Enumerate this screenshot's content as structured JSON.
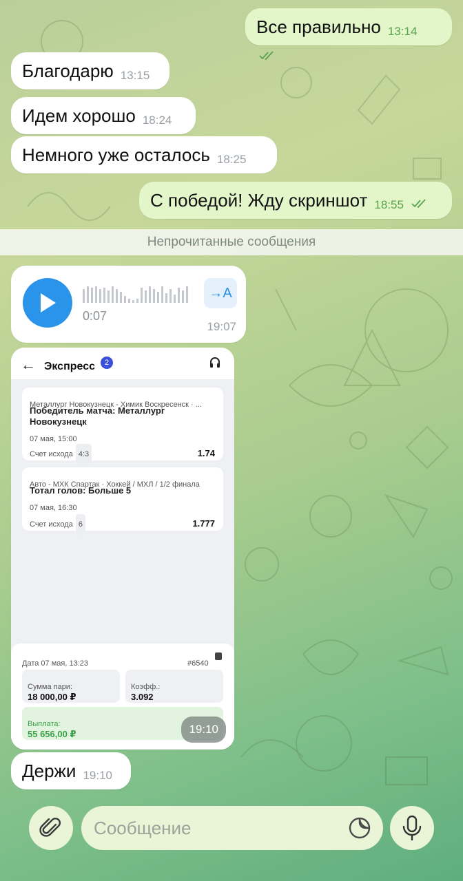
{
  "messages": [
    {
      "text": "Все правильно",
      "time": "13:14",
      "dir": "out"
    },
    {
      "text": "Благодарю",
      "time": "13:15",
      "dir": "in"
    },
    {
      "text": "Идем хорошо",
      "time": "18:24",
      "dir": "in"
    },
    {
      "text": "Немного уже осталось",
      "time": "18:25",
      "dir": "in"
    },
    {
      "text": "С победой! Жду скриншот",
      "time": "18:55",
      "dir": "out"
    }
  ],
  "unread_divider": "Непрочитанные сообщения",
  "voice": {
    "duration": "0:07",
    "time": "19:07",
    "transcribe_label": "→A",
    "icon": "play-icon"
  },
  "screenshot": {
    "time": "19:10",
    "header": {
      "title": "Экспресс",
      "badge": "2",
      "back_icon": "arrow-left-icon",
      "support_icon": "headset-icon"
    },
    "cards": [
      {
        "league": "Металлург Новокузнецк - Химик Воскресенск · ...",
        "pick": "Победитель матча: Металлург Новокузнецк",
        "date": "07 мая, 15:00",
        "result_label": "Счет исхода",
        "result": "4:3",
        "odds": "1.74"
      },
      {
        "league": "Авто - МХК Спартак · Хоккей / МХЛ / 1/2 финала",
        "pick": "Тотал голов: Больше 5",
        "date": "07 мая, 16:30",
        "result_label": "Счет исхода",
        "result": "6",
        "odds": "1.777"
      }
    ],
    "bet": {
      "date": "Дата 07 мая, 13:23",
      "number": "#6540",
      "stake_label": "Сумма пари:",
      "stake": "18 000,00 ₽",
      "coef_label": "Коэфф.:",
      "coef": "3.092",
      "payout_label": "Выплата:",
      "payout": "55 656,00 ₽"
    }
  },
  "last_message": {
    "text": "Держи",
    "time": "19:10"
  },
  "input": {
    "placeholder": "Сообщение",
    "attach_icon": "paperclip-icon",
    "sticker_icon": "sticker-icon",
    "mic_icon": "microphone-icon"
  },
  "colors": {
    "accent": "#2a93ea",
    "outgoing": "#e3f6c9",
    "incoming": "#ffffff",
    "payout": "#3aa048"
  }
}
